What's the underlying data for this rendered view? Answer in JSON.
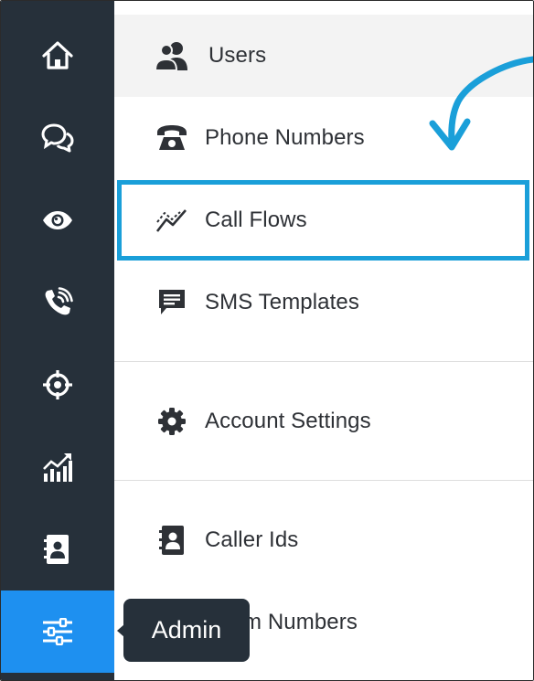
{
  "sidebar": {
    "items": [
      {
        "icon": "home-icon"
      },
      {
        "icon": "chat-bubbles-icon"
      },
      {
        "icon": "eye-icon"
      },
      {
        "icon": "phone-ringing-icon"
      },
      {
        "icon": "crosshair-target-icon"
      },
      {
        "icon": "bar-chart-trend-icon"
      },
      {
        "icon": "contact-book-icon"
      },
      {
        "icon": "sliders-icon",
        "active": true
      }
    ],
    "active_color": "#1e90f0",
    "background": "#26303a"
  },
  "menu": {
    "users_label": "Users",
    "phone_numbers_label": "Phone Numbers",
    "call_flows_label": "Call Flows",
    "sms_templates_label": "SMS Templates",
    "account_settings_label": "Account Settings",
    "caller_ids_label": "Caller Ids",
    "last_item_visible_label": "m Numbers"
  },
  "tooltip": {
    "text": "Admin"
  },
  "highlight_color": "#1a9fd9"
}
